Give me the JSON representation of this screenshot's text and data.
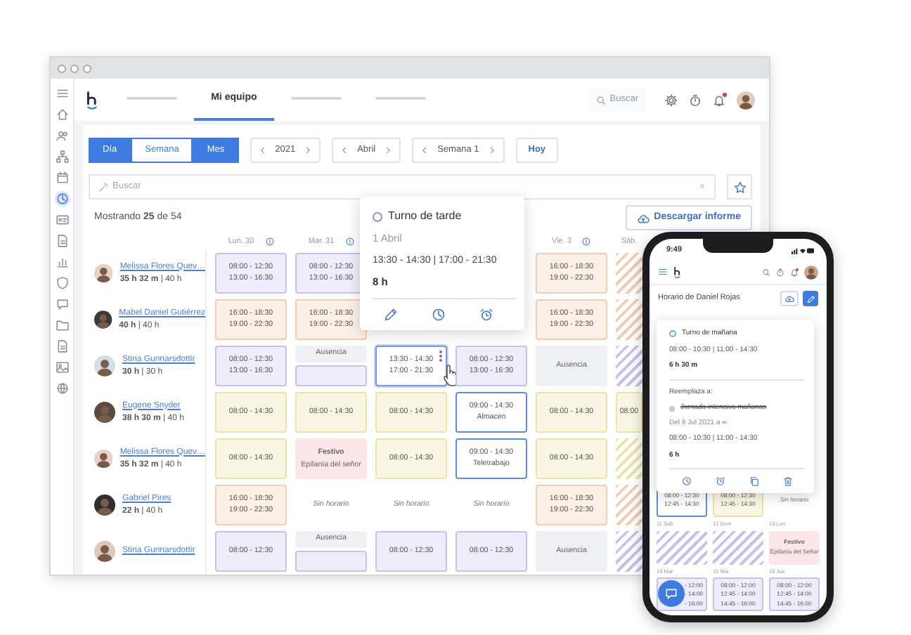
{
  "sidebar": {
    "items": [
      {
        "kind": "menu",
        "selected": false
      },
      {
        "kind": "home",
        "selected": false
      },
      {
        "kind": "people",
        "selected": false
      },
      {
        "kind": "org",
        "selected": false
      },
      {
        "kind": "calendar",
        "selected": false
      },
      {
        "kind": "clock",
        "selected": true
      },
      {
        "kind": "card",
        "selected": false
      },
      {
        "kind": "doc",
        "selected": false
      },
      {
        "kind": "chart",
        "selected": false
      },
      {
        "kind": "shield",
        "selected": false
      },
      {
        "kind": "chat",
        "selected": false
      },
      {
        "kind": "folder",
        "selected": false
      },
      {
        "kind": "doc",
        "selected": false
      },
      {
        "kind": "image",
        "selected": false
      },
      {
        "kind": "globe",
        "selected": false
      }
    ]
  },
  "header": {
    "tabs": [
      {
        "kind": "placeholder",
        "selected": false
      },
      {
        "kind": "label",
        "label": "Mi equipo",
        "selected": true
      },
      {
        "kind": "placeholder",
        "selected": false
      },
      {
        "kind": "placeholder",
        "selected": false
      }
    ],
    "search": {
      "placeholder": "Buscar"
    },
    "notifications": {
      "unread": true
    }
  },
  "toolbar": {
    "views": [
      {
        "label": "Día",
        "selected": false
      },
      {
        "label": "Semana",
        "selected": true
      },
      {
        "label": "Mes",
        "selected": false
      }
    ],
    "steppers": [
      "2021",
      "Abril",
      "Semana 1"
    ],
    "today": "Hoy"
  },
  "filter": {
    "placeholder": "Buscar"
  },
  "summary": "Mostrando **25** de 54",
  "download_button": "Descargar informe",
  "days": [
    {
      "kind": "day",
      "label": "Lun. 30",
      "info": true
    },
    {
      "kind": "day",
      "label": "Mar. 31",
      "info": true
    },
    {
      "kind": "covered"
    },
    {
      "kind": "covered"
    },
    {
      "kind": "day",
      "label": "Vie. 3",
      "info": true
    },
    {
      "kind": "day",
      "label": "Sáb.",
      "info": false
    }
  ],
  "employees": [
    {
      "name": "Melissa Flores Quev…",
      "hours": "**35 h 32 m** | 40 h",
      "cells": [
        {
          "kind": "shift",
          "color": "#c9bff0",
          "lines": [
            "08:00 - 12:30",
            "13:00 - 16:30"
          ]
        },
        {
          "kind": "shift",
          "color": "#c9bff0",
          "lines": [
            "08:00 - 12:30",
            "13:00 - 16:30"
          ]
        },
        {
          "kind": "covered"
        },
        {
          "kind": "covered"
        },
        {
          "kind": "shift",
          "color": "#f2cdb1",
          "lines": [
            "16:00 - 18:30",
            "19:00 - 22:30"
          ]
        },
        {
          "kind": "hatched",
          "color": "#f2cdb1"
        }
      ]
    },
    {
      "name": "Mabel Daniel Gutiérrez",
      "hours": "**40 h** | 40 h",
      "cells": [
        {
          "kind": "shift",
          "color": "#f2cdb1",
          "lines": [
            "16:00 - 18:30",
            "19:00 - 22:30"
          ]
        },
        {
          "kind": "shift",
          "color": "#f2cdb1",
          "lines": [
            "16:00 - 18:30",
            "19:00 - 22:30"
          ]
        },
        {
          "kind": "covered"
        },
        {
          "kind": "covered"
        },
        {
          "kind": "shift",
          "color": "#f2cdb1",
          "lines": [
            "16:00 - 18:30",
            "19:00 - 22:30"
          ]
        },
        {
          "kind": "hatched",
          "color": "#f2cdb1"
        }
      ]
    },
    {
      "name": "Stina Gunnarsdottir",
      "hours": "**30 h** | 30 h",
      "cells": [
        {
          "kind": "shift",
          "color": "#c9bff0",
          "lines": [
            "08:00 - 12:30",
            "13:00 - 16:30"
          ]
        },
        {
          "kind": "absence",
          "label": "Ausencia",
          "color": "#c9bff0"
        },
        {
          "kind": "hovered",
          "lines": [
            "13:30 - 14:30",
            "17:00 - 21:30"
          ]
        },
        {
          "kind": "shift",
          "color": "#c9bff0",
          "lines": [
            "08:00 - 12:30",
            "13:00 - 16:30"
          ]
        },
        {
          "kind": "absence",
          "label": "Ausencia"
        },
        {
          "kind": "hatched",
          "color": "#c9bff0"
        }
      ]
    },
    {
      "name": "Eugene Snyder",
      "hours": "**38 h 30 m** | 40 h",
      "cells": [
        {
          "kind": "shift",
          "color": "#ece3a6",
          "lines": [
            "08:00 - 14:30"
          ]
        },
        {
          "kind": "shift",
          "color": "#ece3a6",
          "lines": [
            "08:00 - 14:30"
          ]
        },
        {
          "kind": "shift",
          "color": "#ece3a6",
          "lines": [
            "08:00 - 14:30"
          ]
        },
        {
          "kind": "outlined",
          "lines": [
            "09:00 - 14:30",
            "Almacen"
          ]
        },
        {
          "kind": "shift",
          "color": "#ece3a6",
          "lines": [
            "08:00 - 14:30"
          ]
        },
        {
          "kind": "shift",
          "color": "#ece3a6",
          "lines": [
            "08:00"
          ]
        }
      ]
    },
    {
      "name": "Melissa Flores Quev…",
      "hours": "**35 h 32 m** | 40 h",
      "cells": [
        {
          "kind": "shift",
          "color": "#ece3a6",
          "lines": [
            "08:00 - 14:30"
          ]
        },
        {
          "kind": "holiday",
          "title": "Festivo",
          "subtitle": "Epifanía del señor"
        },
        {
          "kind": "shift",
          "color": "#ece3a6",
          "lines": [
            "08:00 - 14:30"
          ]
        },
        {
          "kind": "outlined",
          "lines": [
            "09:00 - 14:30",
            "Teletrabajo"
          ]
        },
        {
          "kind": "shift",
          "color": "#ece3a6",
          "lines": [
            "08:00 - 14:30"
          ]
        },
        {
          "kind": "hatched",
          "color": "#ece3a6"
        }
      ]
    },
    {
      "name": "Gabriel Pires",
      "hours": "**22 h** | 40 h",
      "cells": [
        {
          "kind": "shift",
          "color": "#f2cdb1",
          "lines": [
            "16:00 - 18:30",
            "19:00 - 22:30"
          ]
        },
        {
          "kind": "empty",
          "label": "Sin horario"
        },
        {
          "kind": "empty",
          "label": "Sin horario"
        },
        {
          "kind": "empty",
          "label": "Sin horario"
        },
        {
          "kind": "shift",
          "color": "#f2cdb1",
          "lines": [
            "16:00 - 18:30",
            "19:00 - 22:30"
          ]
        },
        {
          "kind": "hatched",
          "color": "#f2cdb1"
        }
      ]
    },
    {
      "name": "Stina Gunnarsdottir",
      "cells": [
        {
          "kind": "shift",
          "color": "#c9bff0",
          "lines": [
            "08:00 - 12:30"
          ]
        },
        {
          "kind": "absence",
          "label": "Ausencia",
          "color": "#c9bff0"
        },
        {
          "kind": "shift",
          "color": "#c9bff0",
          "lines": [
            "08:00 - 12:30"
          ]
        },
        {
          "kind": "shift",
          "color": "#c9bff0",
          "lines": [
            "08:00 - 12:30"
          ]
        },
        {
          "kind": "absence",
          "label": "Ausencia"
        },
        {
          "kind": "hatched",
          "color": "#c9bff0"
        }
      ]
    }
  ],
  "popover": {
    "title": "Turno de tarde",
    "date": "1 Abril",
    "times": "13:30 - 14:30 | 17:00 - 21:30",
    "duration": "8 h",
    "actions": [
      {
        "kind": "pencil"
      },
      {
        "kind": "clock"
      },
      {
        "kind": "alarm"
      }
    ]
  },
  "phone": {
    "time": "9:49",
    "notifications": {
      "unread": true
    },
    "title": "Horario de Daniel Rojas",
    "popover": {
      "title": "Turno de mañana",
      "times": "08:00 - 10:30 | 11:00 - 14:30",
      "duration": "6 h 30 m",
      "replaces_label": "Reemplaza a:",
      "replaced": {
        "name": "Jornada intensiva mañanas",
        "color": "#c9bff0",
        "struck": true,
        "range": "Del 9 Jul 2021 a ∞",
        "times": "08:00 - 10:30 | 11:00 - 14:30",
        "duration": "6 h"
      },
      "actions": [
        {
          "kind": "clock"
        },
        {
          "kind": "alarm"
        },
        {
          "kind": "copy"
        },
        {
          "kind": "trash"
        }
      ]
    },
    "weeks": [
      {
        "cells": [
          {
            "kind": "outlined",
            "lines": [
              "08:00 - 12:30",
              "12:45 - 14:30"
            ]
          },
          {
            "kind": "shift",
            "color": "#ece3a6",
            "lines": [
              "08:00 - 12:30",
              "12:45 - 14:30"
            ]
          },
          {
            "kind": "empty",
            "label": "Sin horario"
          }
        ]
      },
      {
        "days": [
          "11 Sáb",
          "12 Dom",
          "13 Lun"
        ],
        "cells": [
          {
            "kind": "hatched",
            "color": "#c9bff0"
          },
          {
            "kind": "hatched",
            "color": "#c9bff0"
          },
          {
            "kind": "holiday",
            "title": "Festivo",
            "subtitle": "Epifanía del Señor"
          }
        ]
      },
      {
        "days": [
          "14 Mar",
          "15 Mié",
          "16 Jue"
        ],
        "cells": [
          {
            "kind": "shift",
            "color": "#c9bff0",
            "partial": true,
            "lines": [
              "- 12:00",
              "- 14:00",
              "- 16:00"
            ]
          },
          {
            "kind": "shift",
            "color": "#c9bff0",
            "lines": [
              "08:00 - 12:00",
              "12:45 - 14:00",
              "14:45 - 16:00"
            ]
          },
          {
            "kind": "shift",
            "color": "#c9bff0",
            "lines": [
              "08:00 - 12:00",
              "12:45 - 14:00",
              "14:45 - 16:00"
            ]
          }
        ]
      }
    ]
  }
}
